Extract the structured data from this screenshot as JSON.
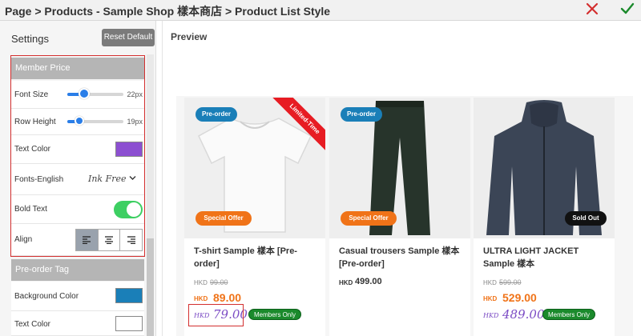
{
  "header": {
    "title": "Page > Products - Sample Shop 樣本商店 > Product List Style",
    "close_icon": "close-icon",
    "confirm_icon": "check-icon",
    "close_color": "#d32f2f",
    "confirm_color": "#1b8a2c"
  },
  "settings": {
    "title": "Settings",
    "reset_label": "Reset Default",
    "member_section": {
      "title": "Member Price",
      "font_size_label": "Font Size",
      "font_size_value": "22px",
      "font_size_level": 0.4,
      "row_height_label": "Row Height",
      "row_height_value": "19px",
      "row_height_level": 0.3,
      "text_color_label": "Text Color",
      "text_color": "#8c4fd1",
      "fonts_label": "Fonts-English",
      "fonts_value": "Ink Free",
      "bold_label": "Bold Text",
      "bold_on": true,
      "align_label": "Align",
      "align_options": [
        "left",
        "center",
        "right"
      ],
      "align_selected": "left"
    },
    "preorder_section": {
      "title": "Pre-order Tag",
      "bg_color_label": "Background Color",
      "bg_color": "#1a7fb8",
      "text_color_label": "Text Color",
      "text_color": "#ffffff"
    }
  },
  "preview": {
    "title": "Preview",
    "products": [
      {
        "name": "T-shirt Sample 樣本 [Pre-order]",
        "tag_top": "Pre-order",
        "tag_bottom": "Special Offer",
        "ribbon": "Limited-Time",
        "orig_currency": "HKD",
        "orig_price": "99.00",
        "currency": "HKD",
        "price": "89.00",
        "member_currency": "HKD",
        "member_price": "79.00",
        "members_badge": "Members Only"
      },
      {
        "name": "Casual trousers Sample 樣本 [Pre-order]",
        "tag_top": "Pre-order",
        "tag_bottom": "Special Offer",
        "currency": "HKD",
        "price": "499.00"
      },
      {
        "name": "ULTRA LIGHT JACKET Sample 樣本",
        "tag_bottom": "Sold Out",
        "orig_currency": "HKD",
        "orig_price": "599.00",
        "currency": "HKD",
        "price": "529.00",
        "member_currency": "HKD",
        "member_price": "489.00",
        "members_badge": "Members Only"
      }
    ]
  }
}
